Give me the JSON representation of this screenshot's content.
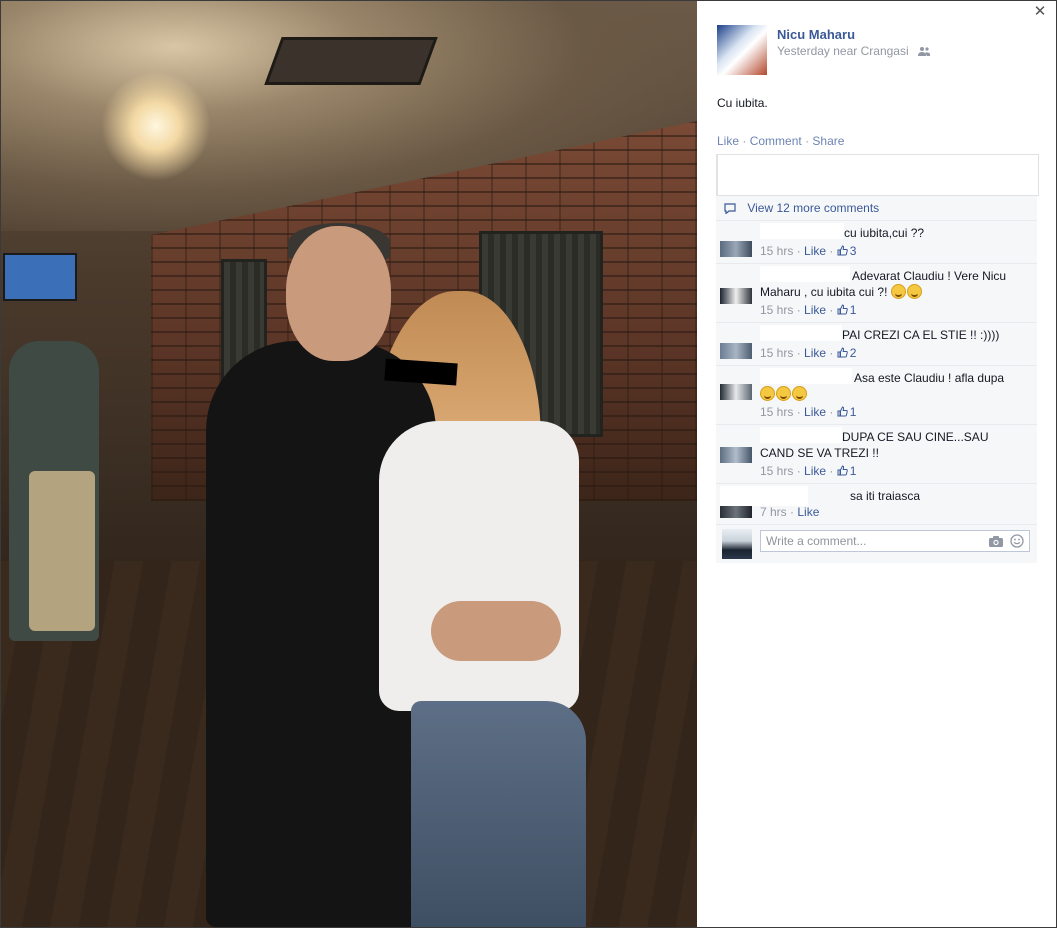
{
  "post": {
    "author": "Nicu Maharu",
    "meta": "Yesterday near Crangasi",
    "audience_icon": "friends-icon",
    "caption": "Cu iubita.",
    "actions": {
      "like": "Like",
      "comment": "Comment",
      "share": "Share",
      "sep": "·"
    }
  },
  "comments_section": {
    "view_more": "View 12 more comments",
    "items": [
      {
        "text": "cu iubita,cui ??",
        "time": "15 hrs",
        "like": "Like",
        "likes": "3"
      },
      {
        "text": "Adevarat Claudiu ! Vere Nicu",
        "text2": "Maharu , cu iubita cui ?!",
        "time": "15 hrs",
        "like": "Like",
        "likes": "1"
      },
      {
        "text": "PAI CREZI CA EL STIE !! :))))",
        "time": "15 hrs",
        "like": "Like",
        "likes": "2"
      },
      {
        "text": "Asa este Claudiu ! afla dupa",
        "time": "15 hrs",
        "like": "Like",
        "likes": "1"
      },
      {
        "text": "DUPA CE SAU CINE...SAU",
        "text2": "CAND SE VA TREZI !!",
        "time": "15 hrs",
        "like": "Like",
        "likes": "1"
      },
      {
        "text": "sa iti traiasca",
        "time": "7 hrs",
        "like": "Like"
      }
    ],
    "write_placeholder": "Write a comment..."
  },
  "close_symbol": "✕"
}
